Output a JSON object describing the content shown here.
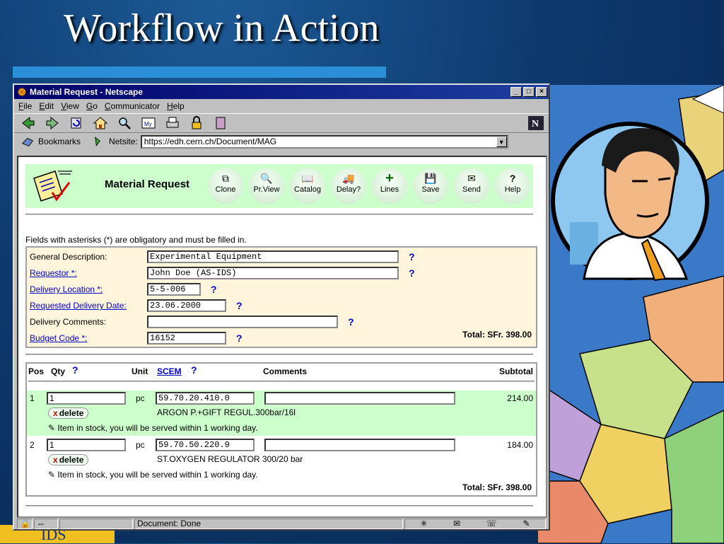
{
  "slide": {
    "title": "Workflow in Action",
    "logo_text": "IDS"
  },
  "window": {
    "title": "Material Request - Netscape"
  },
  "menubar": [
    {
      "accel": "F",
      "rest": "ile"
    },
    {
      "accel": "E",
      "rest": "dit"
    },
    {
      "accel": "V",
      "rest": "iew"
    },
    {
      "accel": "G",
      "rest": "o"
    },
    {
      "accel": "C",
      "rest": "ommunicator"
    },
    {
      "accel": "H",
      "rest": "elp"
    }
  ],
  "locationbar": {
    "bookmarks_label": "Bookmarks",
    "netsite_label": "Netsite:",
    "url": "https://edh.cern.ch/Document/MAG"
  },
  "form": {
    "title": "Material Request",
    "buttons": [
      {
        "label": "Clone",
        "icon": "⧉"
      },
      {
        "label": "Pr.View",
        "icon": "🔍"
      },
      {
        "label": "Catalog",
        "icon": "📖"
      },
      {
        "label": "Delay?",
        "icon": "🚚"
      },
      {
        "label": "Lines",
        "icon": "+"
      },
      {
        "label": "Save",
        "icon": "💾"
      },
      {
        "label": "Send",
        "icon": "✉"
      },
      {
        "label": "Help",
        "icon": "?"
      }
    ],
    "note": "Fields with asterisks (*) are obligatory and must be filled in.",
    "fields": [
      {
        "label": "General Description:",
        "value": "Experimental Equipment"
      },
      {
        "label": "Requestor *:",
        "value": "John Doe (AS-IDS)"
      },
      {
        "label": "Delivery Location *:",
        "value": "5-5-006"
      },
      {
        "label": "Requested Delivery Date:",
        "value": "23.06.2000"
      },
      {
        "label": "Delivery Comments:",
        "value": ""
      },
      {
        "label": "Budget Code *:",
        "value": "16152"
      }
    ],
    "help_mark": "?",
    "total_top": "Total: SFr. 398.00"
  },
  "items_table": {
    "headers": {
      "pos": "Pos",
      "qty": "Qty",
      "unit": "Unit",
      "scem": "SCEM",
      "comments": "Comments",
      "subtotal": "Subtotal"
    },
    "rows": [
      {
        "pos": "1",
        "qty": "1",
        "unit": "pc",
        "scem": "59.70.20.410.0",
        "subtotal": "214.00",
        "delete": "delete",
        "description": "ARGON P.+GIFT REGUL.300bar/16l",
        "stock": "Item in stock, you will be served within 1 working day."
      },
      {
        "pos": "2",
        "qty": "1",
        "unit": "pc",
        "scem": "59.70.50.220.9",
        "subtotal": "184.00",
        "delete": "delete",
        "description": "ST.OXYGEN REGULATOR 300/20 bar",
        "stock": "Item in stock, you will be served within 1 working day."
      }
    ],
    "total": "Total:  SFr. 398.00"
  },
  "status": {
    "text": "Document: Done"
  }
}
